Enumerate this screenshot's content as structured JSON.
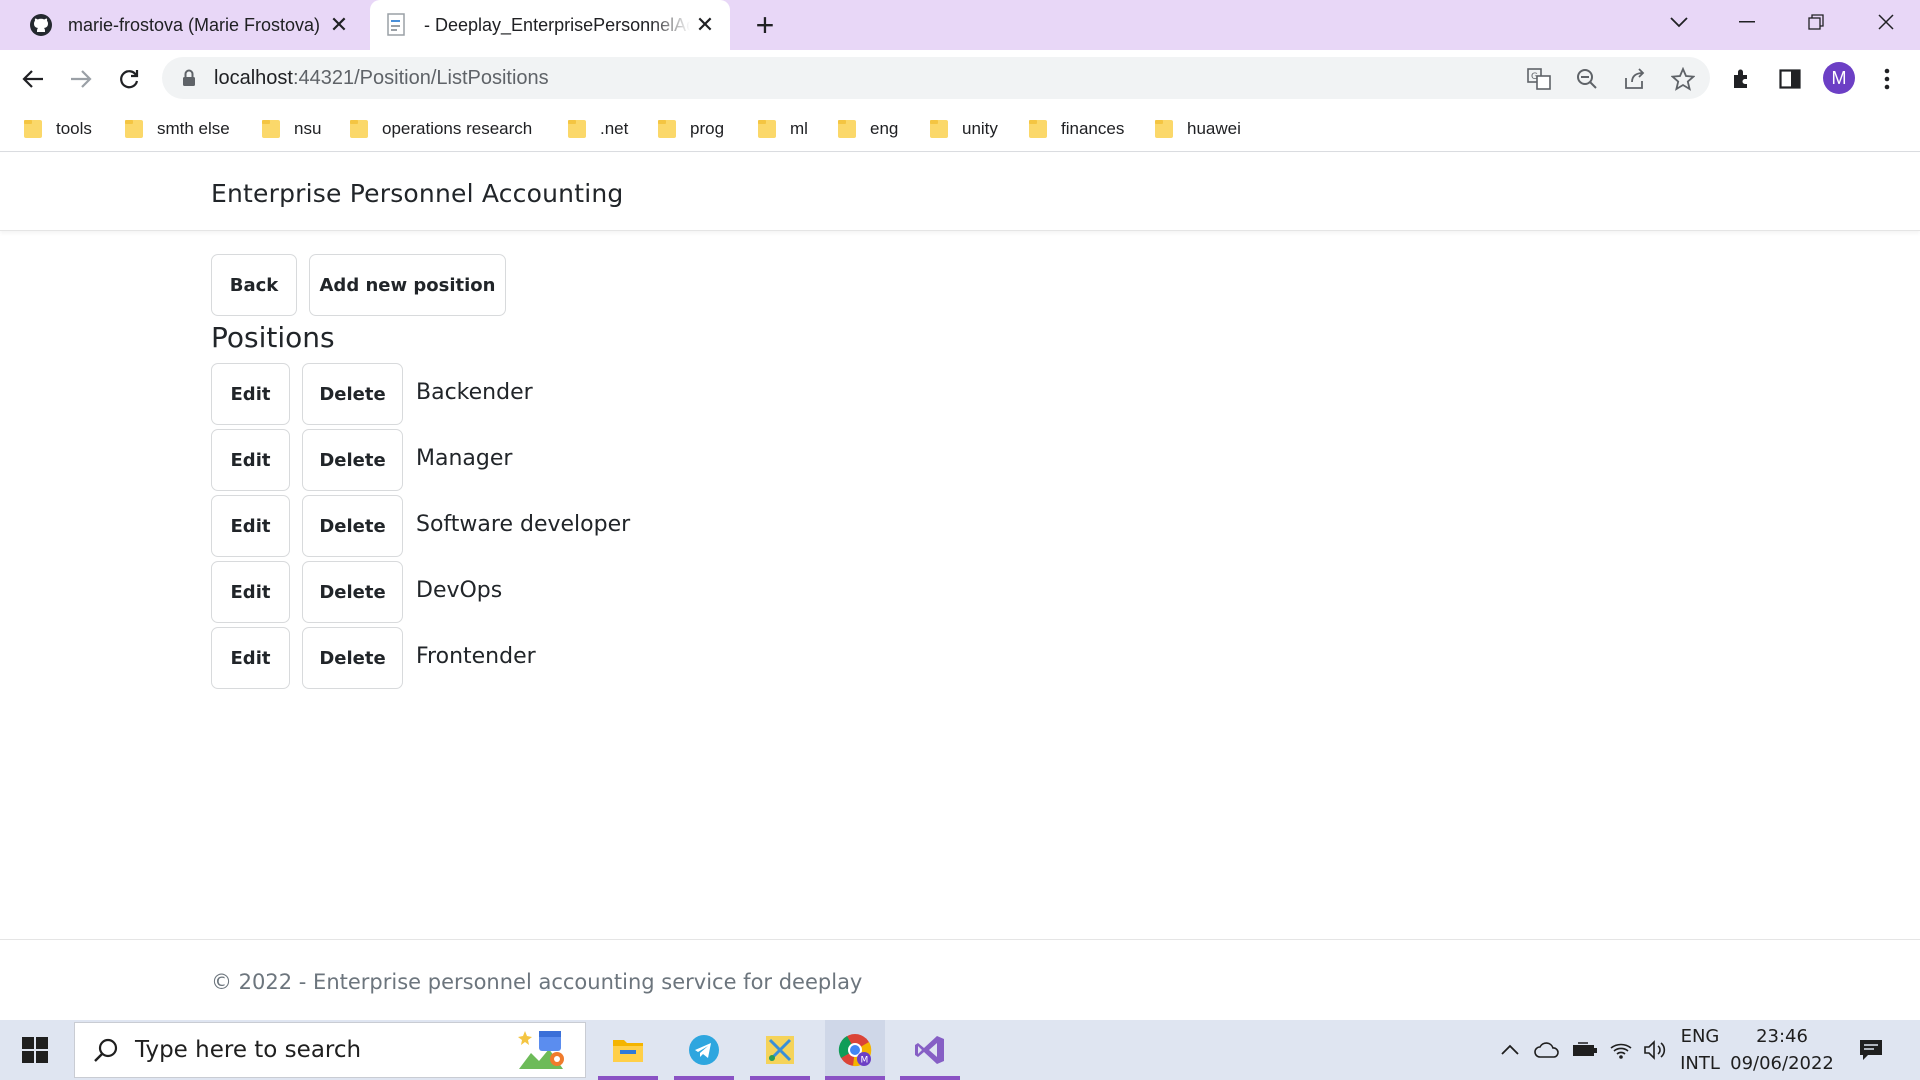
{
  "browser": {
    "tabs": [
      {
        "title": "marie-frostova (Marie Frostova)",
        "favicon": "github-icon",
        "active": false
      },
      {
        "title": "- Deeplay_EnterprisePersonnelAccounting",
        "favicon": "page-icon",
        "active": true
      }
    ],
    "url_host": "localhost",
    "url_path": ":44321/Position/ListPositions",
    "profile_initial": "M",
    "bookmarks": [
      "tools",
      "smth else",
      "nsu",
      "operations research",
      ".net",
      "prog",
      "ml",
      "eng",
      "unity",
      "finances",
      "huawei"
    ],
    "colors": {
      "tabstrip": "#e8d7f7",
      "avatar": "#6c3fc5",
      "folder": "#fbd86a"
    }
  },
  "page": {
    "brand": "Enterprise Personnel Accounting",
    "actions": {
      "back_label": "Back",
      "add_label": "Add new position"
    },
    "heading": "Positions",
    "row_actions": {
      "edit_label": "Edit",
      "delete_label": "Delete"
    },
    "positions": [
      "Backender",
      "Manager",
      "Software developer",
      "DevOps",
      "Frontender"
    ],
    "footer": "© 2022 - Enterprise personnel accounting service for deeplay"
  },
  "taskbar": {
    "search_placeholder": "Type here to search",
    "lang_top": "ENG",
    "lang_bottom": "INTL",
    "time": "23:46",
    "date": "09/06/2022",
    "apps": [
      "file-explorer-icon",
      "telegram-icon",
      "snipping-tool-icon",
      "chrome-icon",
      "visual-studio-icon"
    ]
  }
}
